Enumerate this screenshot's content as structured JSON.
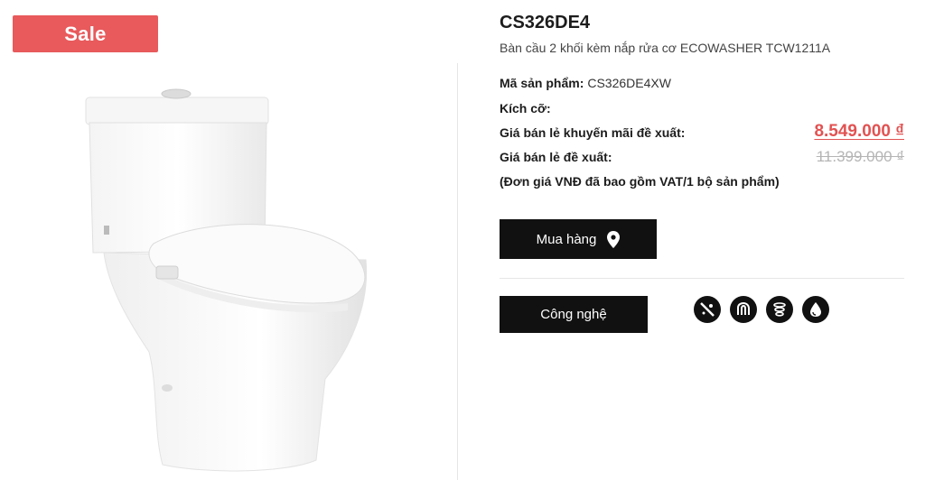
{
  "badge": {
    "label": "Sale"
  },
  "product": {
    "code": "CS326DE4",
    "name": "Bàn cầu 2 khối kèm nắp rửa cơ ECOWASHER TCW1211A",
    "sku_label": "Mã sản phẩm:",
    "sku_value": "CS326DE4XW",
    "size_label": "Kích cỡ:",
    "size_value": "",
    "promo_label": "Giá bán lẻ khuyến mãi đề xuất:",
    "promo_price": "8.549.000 ₫",
    "retail_label": "Giá bán lẻ đề xuất:",
    "retail_price": "11.399.000 ₫",
    "vat_note": "(Đơn giá VNĐ đã bao gồm VAT/1 bộ sản phẩm)"
  },
  "actions": {
    "buy_label": "Mua hàng",
    "tech_label": "Công nghệ"
  },
  "tech_icons": [
    "cefiontect-icon",
    "tornado-flush-icon",
    "swirl-flush-icon",
    "water-drop-icon"
  ],
  "colors": {
    "sale": "#e85a5c",
    "price": "#e25252",
    "button": "#111111"
  }
}
